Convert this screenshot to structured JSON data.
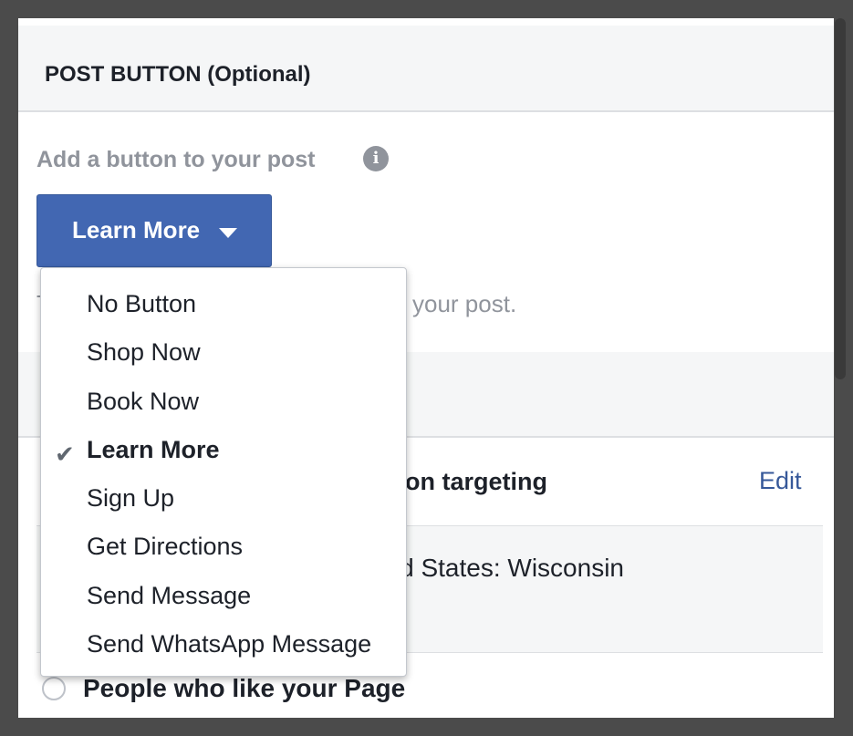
{
  "post_button_section": {
    "title": "POST BUTTON (Optional)",
    "add_label": "Add a button to your post",
    "info_icon": "info-icon",
    "button_label": "Learn More",
    "helper_text_start": "T",
    "helper_text_end": "your post."
  },
  "dropdown": {
    "options": [
      {
        "label": "No Button"
      },
      {
        "label": "Shop Now"
      },
      {
        "label": "Book Now"
      },
      {
        "label": "Learn More",
        "selected": true
      },
      {
        "label": "Sign Up"
      },
      {
        "label": "Get Directions"
      },
      {
        "label": "Send Message"
      },
      {
        "label": "Send WhatsApp Message"
      }
    ],
    "check_icon": "checkmark-icon"
  },
  "audience": {
    "targeting_label": "Location targeting",
    "edit_label": "Edit",
    "location_text": "United States: Wisconsin",
    "radio_label": "People who like your Page"
  },
  "colors": {
    "primary_button": "#4267b2",
    "link": "#365899",
    "muted_text": "#90949c"
  }
}
